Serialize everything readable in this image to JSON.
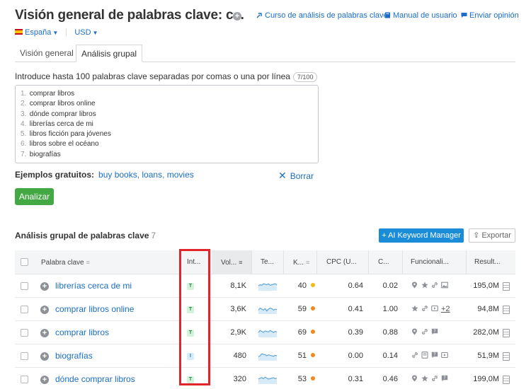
{
  "header": {
    "title": "Visión general de palabras clave: c...",
    "links": [
      {
        "label": "Curso de análisis de palabras clave",
        "icon": "course-icon"
      },
      {
        "label": "Manual de usuario",
        "icon": "book-icon"
      },
      {
        "label": "Enviar opinión",
        "icon": "chat-icon"
      }
    ],
    "country": "España",
    "currency": "USD"
  },
  "tabs": [
    {
      "label": "Visión general",
      "active": false
    },
    {
      "label": "Análisis grupal",
      "active": true
    }
  ],
  "input": {
    "instructions": "Introduce hasta 100 palabras clave separadas por comas o una por línea",
    "counter": "7/100",
    "keywords": [
      "comprar libros",
      "comprar libros online",
      "dónde comprar libros",
      "librerías cerca de mi",
      "libros ficción para jóvenes",
      "libros sobre el océano",
      "biografías"
    ],
    "examples_label": "Ejemplos gratuitos:",
    "examples": "buy books, loans, movies",
    "clear_label": "Borrar",
    "analyze_label": "Analizar"
  },
  "results": {
    "title": "Análisis grupal de palabras clave",
    "count": "7",
    "akm_label": "AI Keyword Manager",
    "export_label": "Exportar",
    "columns": {
      "keyword": "Palabra clave",
      "intent": "Int...",
      "volume": "Vol...",
      "trend": "Te...",
      "kd": "K...",
      "cpc": "CPC (U...",
      "com": "C...",
      "features": "Funcionali...",
      "results": "Result..."
    },
    "rows": [
      {
        "keyword": "librerías cerca de mi",
        "intent": "T",
        "volume": "8,1K",
        "kd": "40",
        "kd_color": "#f5b914",
        "cpc": "0.64",
        "com": "0.02",
        "features": [
          "pin-icon",
          "star-icon",
          "link-icon",
          "image-icon"
        ],
        "more": "",
        "results": "195,0M",
        "trend": [
          0.5,
          0.6,
          0.55,
          0.7,
          0.65,
          0.6,
          0.7,
          0.55,
          0.6,
          0.65,
          0.7,
          0.6
        ]
      },
      {
        "keyword": "comprar libros online",
        "intent": "T",
        "volume": "3,6K",
        "kd": "59",
        "kd_color": "#f08a1c",
        "cpc": "0.41",
        "com": "1.00",
        "features": [
          "star-icon",
          "link-icon",
          "video-icon"
        ],
        "more": "+2",
        "results": "94,8M",
        "trend": [
          0.4,
          0.6,
          0.5,
          0.4,
          0.55,
          0.3,
          0.5,
          0.6,
          0.55,
          0.4,
          0.5,
          0.45
        ]
      },
      {
        "keyword": "comprar libros",
        "intent": "T",
        "volume": "2,9K",
        "kd": "69",
        "kd_color": "#f08a1c",
        "cpc": "0.39",
        "com": "0.88",
        "features": [
          "pin-icon",
          "link-icon",
          "faq-icon"
        ],
        "more": "",
        "results": "282,0M",
        "trend": [
          0.5,
          0.7,
          0.6,
          0.5,
          0.65,
          0.6,
          0.55,
          0.7,
          0.6,
          0.5,
          0.6,
          0.55
        ]
      },
      {
        "keyword": "biografías",
        "intent": "I",
        "volume": "480",
        "kd": "51",
        "kd_color": "#f08a1c",
        "cpc": "0.00",
        "com": "0.14",
        "features": [
          "link-icon",
          "book-icon",
          "faq-icon",
          "video-icon"
        ],
        "more": "",
        "results": "51,9M",
        "trend": [
          0.4,
          0.5,
          0.7,
          0.65,
          0.6,
          0.5,
          0.6,
          0.55,
          0.5,
          0.45,
          0.55,
          0.5
        ]
      },
      {
        "keyword": "dónde comprar libros",
        "intent": "T",
        "volume": "320",
        "kd": "53",
        "kd_color": "#f08a1c",
        "cpc": "0.31",
        "com": "0.46",
        "features": [
          "pin-icon",
          "star-icon",
          "link-icon",
          "faq-icon"
        ],
        "more": "",
        "results": "199,0M",
        "trend": [
          0.5,
          0.6,
          0.65,
          0.55,
          0.7,
          0.6,
          0.5,
          0.55,
          0.6,
          0.65,
          0.55,
          0.6
        ]
      }
    ]
  },
  "colors": {
    "link": "#1a6ec6",
    "primary": "#1a8cd8",
    "analyze": "#44a944",
    "highlight": "#e1252b"
  }
}
